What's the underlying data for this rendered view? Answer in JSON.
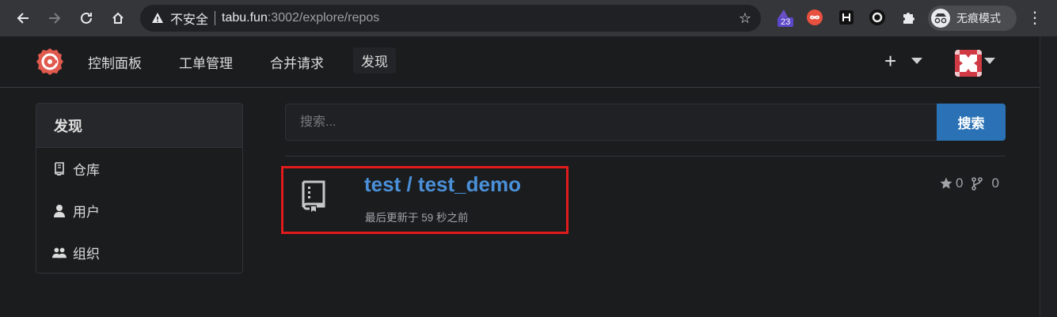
{
  "browser": {
    "insecure_label": "不安全",
    "url_host": "tabu.fun",
    "url_rest": ":3002/explore/repos",
    "extension_badge": "23",
    "incognito_label": "无痕模式"
  },
  "header": {
    "nav": [
      "控制面板",
      "工单管理",
      "合并请求",
      "发现"
    ],
    "active_nav": "发现",
    "plus_label": "+"
  },
  "sidebar": {
    "title": "发现",
    "items": [
      {
        "label": "仓库",
        "icon": "repo-icon"
      },
      {
        "label": "用户",
        "icon": "person-icon"
      },
      {
        "label": "组织",
        "icon": "organization-icon"
      }
    ]
  },
  "search": {
    "placeholder": "搜索...",
    "button_label": "搜索"
  },
  "repos": [
    {
      "title": "test / test_demo",
      "updated": "最后更新于 59 秒之前",
      "stars": "0",
      "forks": "0"
    }
  ],
  "colors": {
    "accent": "#2a72b5",
    "link": "#4a90d9",
    "highlight": "#e01b1b",
    "background": "#1b1c1e"
  }
}
